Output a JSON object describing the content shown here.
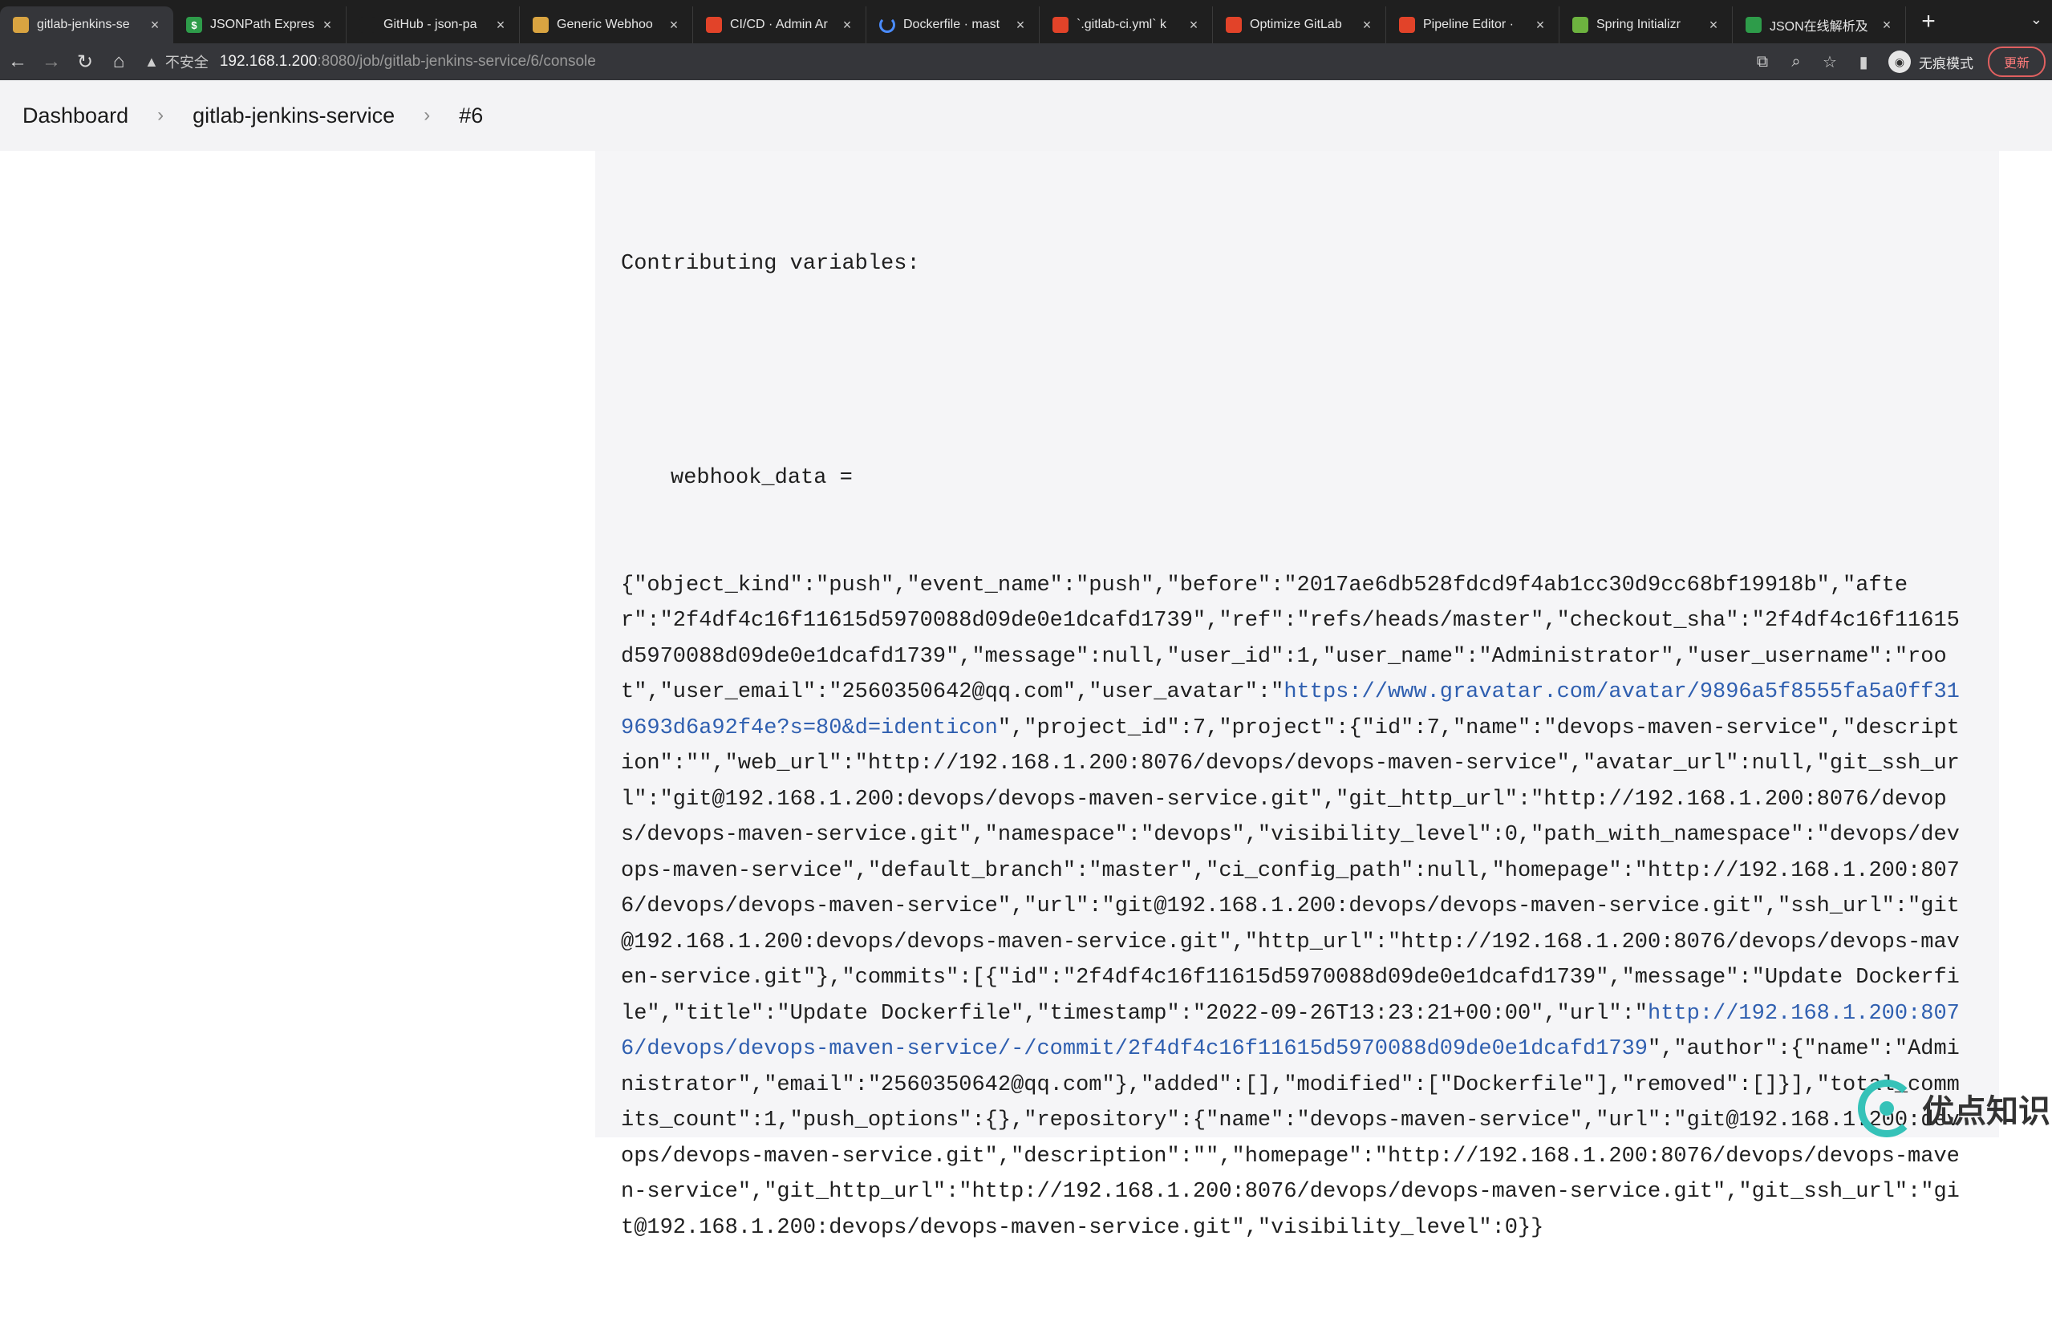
{
  "browser": {
    "tabs": [
      {
        "title": "gitlab-jenkins-se",
        "favicon": "jenkins",
        "color": "#d9a441",
        "active": true
      },
      {
        "title": "JSONPath Expres",
        "favicon": "$",
        "color": "#2e9c4a"
      },
      {
        "title": "GitHub - json-pa",
        "favicon": "github",
        "color": "#1f1f1f"
      },
      {
        "title": "Generic Webhoo",
        "favicon": "jenkins",
        "color": "#d9a441"
      },
      {
        "title": "CI/CD · Admin Ar",
        "favicon": "gitlab",
        "color": "#e24329"
      },
      {
        "title": "Dockerfile · mast",
        "favicon": "loading",
        "color": "#4a8cff"
      },
      {
        "title": "`.gitlab-ci.yml` k",
        "favicon": "gitlab",
        "color": "#e24329"
      },
      {
        "title": "Optimize GitLab",
        "favicon": "gitlab",
        "color": "#e24329"
      },
      {
        "title": "Pipeline Editor ·",
        "favicon": "gitlab",
        "color": "#e24329"
      },
      {
        "title": "Spring Initializr",
        "favicon": "spring",
        "color": "#6db33f"
      },
      {
        "title": "JSON在线解析及",
        "favicon": "json",
        "color": "#2e9c4a"
      }
    ],
    "new_tab": "+",
    "address": {
      "insecure_label": "不安全",
      "host": "192.168.1.200",
      "path": ":8080/job/gitlab-jenkins-service/6/console"
    },
    "incognito_label": "无痕模式",
    "update_label": "更新"
  },
  "breadcrumb": {
    "items": [
      "Dashboard",
      "gitlab-jenkins-service",
      "#6"
    ],
    "separator": "›"
  },
  "console": {
    "heading": "Contributing variables:",
    "var_line": "webhook_data =",
    "segments": [
      {
        "t": "{\"object_kind\":\"push\",\"event_name\":\"push\",\"before\":\"2017ae6db528fdcd9f4ab1cc30d9cc68bf19918b\",\"after\":\"2f4df4c16f11615d5970088d09de0e1dcafd1739\",\"ref\":\"refs/heads/master\",\"checkout_sha\":\"2f4df4c16f11615d5970088d09de0e1dcafd1739\",\"message\":null,\"user_id\":1,\"user_name\":\"Administrator\",\"user_username\":\"root\",\"user_email\":\"2560350642@qq.com\",\"user_avatar\":\""
      },
      {
        "t": "https://www.gravatar.com/avatar/9896a5f8555fa5a0ff319693d6a92f4e?s=80&d=identicon",
        "link": true
      },
      {
        "t": "\",\"project_id\":7,\"project\":{\"id\":7,\"name\":\"devops-maven-service\",\"description\":\"\",\"web_url\":\"http://192.168.1.200:8076/devops/devops-maven-service\",\"avatar_url\":null,\"git_ssh_url\":\"git@192.168.1.200:devops/devops-maven-service.git\",\"git_http_url\":\"http://192.168.1.200:8076/devops/devops-maven-service.git\",\"namespace\":\"devops\",\"visibility_level\":0,\"path_with_namespace\":\"devops/devops-maven-service\",\"default_branch\":\"master\",\"ci_config_path\":null,\"homepage\":\"http://192.168.1.200:8076/devops/devops-maven-service\",\"url\":\"git@192.168.1.200:devops/devops-maven-service.git\",\"ssh_url\":\"git@192.168.1.200:devops/devops-maven-service.git\",\"http_url\":\"http://192.168.1.200:8076/devops/devops-maven-service.git\"},\"commits\":[{\"id\":\"2f4df4c16f11615d5970088d09de0e1dcafd1739\",\"message\":\"Update Dockerfile\",\"title\":\"Update Dockerfile\",\"timestamp\":\"2022-09-26T13:23:21+00:00\",\"url\":\""
      },
      {
        "t": "http://192.168.1.200:8076/devops/devops-maven-service/-/commit/2f4df4c16f11615d5970088d09de0e1dcafd1739",
        "link": true
      },
      {
        "t": "\",\"author\":{\"name\":\"Administrator\",\"email\":\"2560350642@qq.com\"},\"added\":[],\"modified\":[\"Dockerfile\"],\"removed\":[]}],\"total_commits_count\":1,\"push_options\":{},\"repository\":{\"name\":\"devops-maven-service\",\"url\":\"git@192.168.1.200:devops/devops-maven-service.git\",\"description\":\"\",\"homepage\":\"http://192.168.1.200:8076/devops/devops-maven-service\",\"git_http_url\":\"http://192.168.1.200:8076/devops/devops-maven-service.git\",\"git_ssh_url\":\"git@192.168.1.200:devops/devops-maven-service.git\",\"visibility_level\":0}}"
      }
    ]
  },
  "watermark": {
    "text": "优点知识",
    "color": "#35c2b8"
  }
}
